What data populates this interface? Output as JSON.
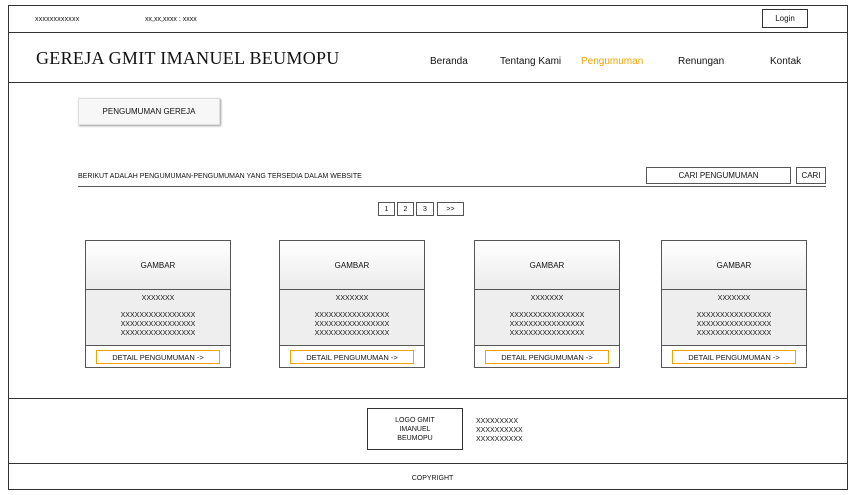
{
  "topbar": {
    "id_text": "xxxxxxxxxxxx",
    "date_text": "xx,xx,xxxx : xxxx",
    "login_label": "Login"
  },
  "header": {
    "site_title": "GEREJA GMIT IMANUEL BEUMOPU",
    "nav": [
      "Beranda",
      "Tentang Kami",
      "Pengumuman",
      "Renungan",
      "Kontak"
    ],
    "active_nav": "Pengumuman",
    "accent_color": "#f5a100"
  },
  "main": {
    "section_label": "PENGUMUMAN GEREJA",
    "intro": "BERIKUT ADALAH PENGUMUMAN-PENGUMUMAN YANG TERSEDIA DALAM WEBSITE",
    "search_label": "CARI PENGUMUMAN",
    "search_button": "CARI",
    "pagination": [
      "1",
      "2",
      "3",
      ">>"
    ],
    "cards": [
      {
        "image_label": "GAMBAR",
        "title": "XXXXXXX",
        "desc": [
          "XXXXXXXXXXXXXXXX",
          "XXXXXXXXXXXXXXXX",
          "XXXXXXXXXXXXXXXX"
        ],
        "detail_label": "DETAIL PENGUMUMAN ->"
      },
      {
        "image_label": "GAMBAR",
        "title": "XXXXXXX",
        "desc": [
          "XXXXXXXXXXXXXXXX",
          "XXXXXXXXXXXXXXXX",
          "XXXXXXXXXXXXXXXX"
        ],
        "detail_label": "DETAIL PENGUMUMAN ->"
      },
      {
        "image_label": "GAMBAR",
        "title": "XXXXXXX",
        "desc": [
          "XXXXXXXXXXXXXXXX",
          "XXXXXXXXXXXXXXXX",
          "XXXXXXXXXXXXXXXX"
        ],
        "detail_label": "DETAIL PENGUMUMAN ->"
      },
      {
        "image_label": "GAMBAR",
        "title": "XXXXXXX",
        "desc": [
          "XXXXXXXXXXXXXXXX",
          "XXXXXXXXXXXXXXXX",
          "XXXXXXXXXXXXXXXX"
        ],
        "detail_label": "DETAIL PENGUMUMAN ->"
      }
    ]
  },
  "footer": {
    "logo_lines": [
      "LOGO GMIT",
      "IMANUEL",
      "BEUMOPU"
    ],
    "info_lines": [
      "XXXXXXXXX",
      "XXXXXXXXXX",
      "XXXXXXXXXX"
    ],
    "copyright": "COPYRIGHT"
  }
}
